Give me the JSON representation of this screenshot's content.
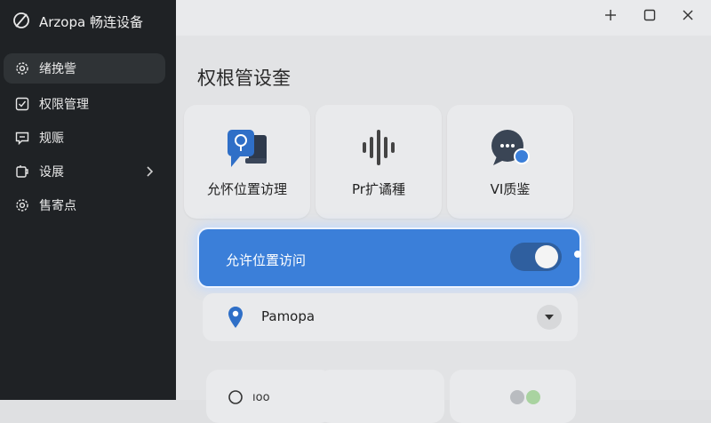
{
  "app": {
    "title": "Arzopa 畅连设备"
  },
  "sidebar": {
    "items": [
      {
        "label": "绪挽訾",
        "icon": "gear-icon"
      },
      {
        "label": "权限管理",
        "icon": "checkbox-icon"
      },
      {
        "label": "规赈",
        "icon": "message-icon"
      },
      {
        "label": "设展",
        "icon": "extension-icon"
      },
      {
        "label": "售寄点",
        "icon": "gear-icon"
      }
    ]
  },
  "window_controls": {
    "minimize": "+",
    "maximize": "□",
    "close": "✕"
  },
  "main": {
    "page_title": "权根管设奎",
    "cards": [
      {
        "label": "允怀位置访理",
        "icon": "location-devices-icon"
      },
      {
        "label": "Pr扩谲種",
        "icon": "audio-wave-icon"
      },
      {
        "label": "VI质鉴",
        "icon": "chat-bubble-icon"
      }
    ],
    "permission": {
      "label": "允许位置访问",
      "toggle_state": "on"
    },
    "location_select": {
      "value": "Pamopa"
    },
    "bottom_text": "ıoo"
  },
  "colors": {
    "accent": "#3b7fd9",
    "sidebar_bg": "#1f2225",
    "main_bg": "#e2e3e5"
  }
}
